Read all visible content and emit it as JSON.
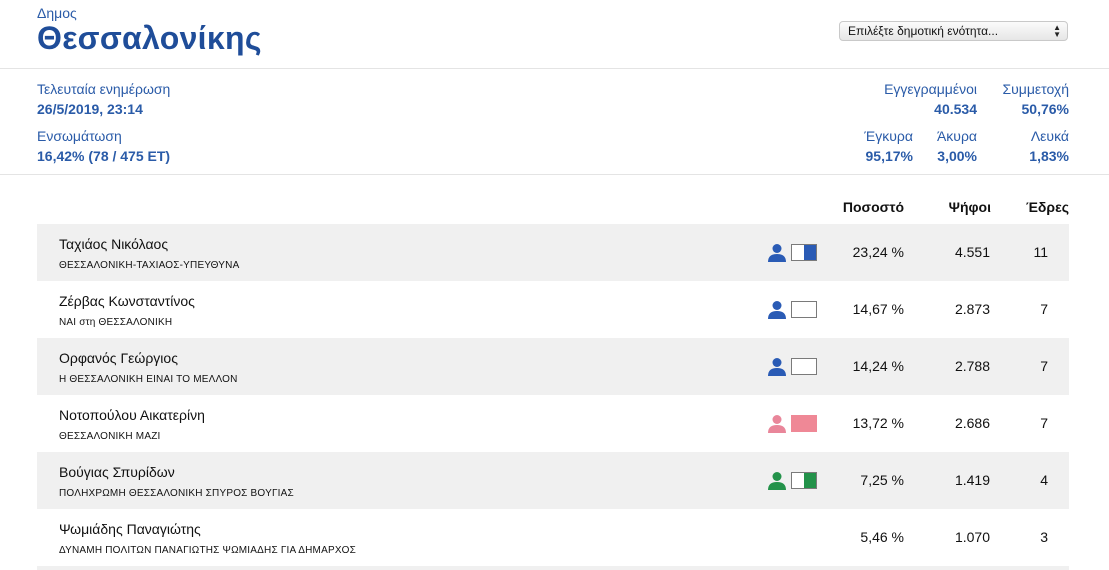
{
  "header": {
    "municipality_label": "Δημος",
    "municipality_name": "Θεσσαλονίκης",
    "unit_select_value": "Επιλέξτε δημοτική ενότητα..."
  },
  "stats": {
    "last_update_label": "Τελευταία ενημέρωση",
    "last_update_value": "26/5/2019, 23:14",
    "integration_label": "Ενσωμάτωση",
    "integration_value": "16,42% (78 / 475 ΕΤ)",
    "registered_label": "Εγγεγραμμένοι",
    "registered_value": "40.534",
    "turnout_label": "Συμμετοχή",
    "turnout_value": "50,76%",
    "valid_label": "Έγκυρα",
    "valid_value": "95,17%",
    "invalid_label": "Άκυρα",
    "invalid_value": "3,00%",
    "blank_label": "Λευκά",
    "blank_value": "1,83%"
  },
  "results": {
    "columns": {
      "percent": "Ποσοστό",
      "votes": "Ψήφοι",
      "seats": "Έδρες"
    },
    "candidates": [
      {
        "name": "Ταχιάος Νικόλαος",
        "party": "ΘΕΣΣΑΛΟΝΙΚΗ-ΤΑΧΙΑΟΣ-ΥΠΕΥΘΥΝΑ",
        "percent": "23,24 %",
        "votes": "4.551",
        "seats": "11",
        "icon": "person-icon",
        "icon_color": "#2a5bb5",
        "swatch": "half",
        "swatch_color": "#2a5bb5"
      },
      {
        "name": "Ζέρβας Κωνσταντίνος",
        "party": "ΝΑΙ στη ΘΕΣΣΑΛΟΝΙΚΗ",
        "percent": "14,67 %",
        "votes": "2.873",
        "seats": "7",
        "icon": "person-icon",
        "icon_color": "#2a5bb5",
        "swatch": "empty",
        "swatch_color": "#ffffff"
      },
      {
        "name": "Ορφανός Γεώργιος",
        "party": "Η ΘΕΣΣΑΛΟΝΙΚΗ ΕΙΝΑΙ ΤΟ ΜΕΛΛΟΝ",
        "percent": "14,24 %",
        "votes": "2.788",
        "seats": "7",
        "icon": "person-icon",
        "icon_color": "#2a5bb5",
        "swatch": "empty",
        "swatch_color": "#ffffff"
      },
      {
        "name": "Νοτοπούλου Αικατερίνη",
        "party": "ΘΕΣΣΑΛΟΝΙΚΗ ΜΑΖΙ",
        "percent": "13,72 %",
        "votes": "2.686",
        "seats": "7",
        "icon": "person-icon",
        "icon_color": "#e9869a",
        "swatch": "full",
        "swatch_color": "#ef8896"
      },
      {
        "name": "Βούγιας Σπυρίδων",
        "party": "ΠΟΛΗΧΡΩΜΗ ΘΕΣΣΑΛΟΝΙΚΗ  ΣΠΥΡΟΣ ΒΟΥΓΙΑΣ",
        "percent": "7,25 %",
        "votes": "1.419",
        "seats": "4",
        "icon": "person-icon",
        "icon_color": "#23924a",
        "swatch": "half",
        "swatch_color": "#23924a"
      },
      {
        "name": "Ψωμιάδης Παναγιώτης",
        "party": "ΔΥΝΑΜΗ ΠΟΛΙΤΩΝ ΠΑΝΑΓΙΩΤΗΣ ΨΩΜΙΑΔΗΣ ΓΙΑ ΔΗΜΑΡΧΟΣ",
        "percent": "5,46 %",
        "votes": "1.070",
        "seats": "3",
        "icon": null,
        "icon_color": null,
        "swatch": "none",
        "swatch_color": null
      }
    ]
  }
}
